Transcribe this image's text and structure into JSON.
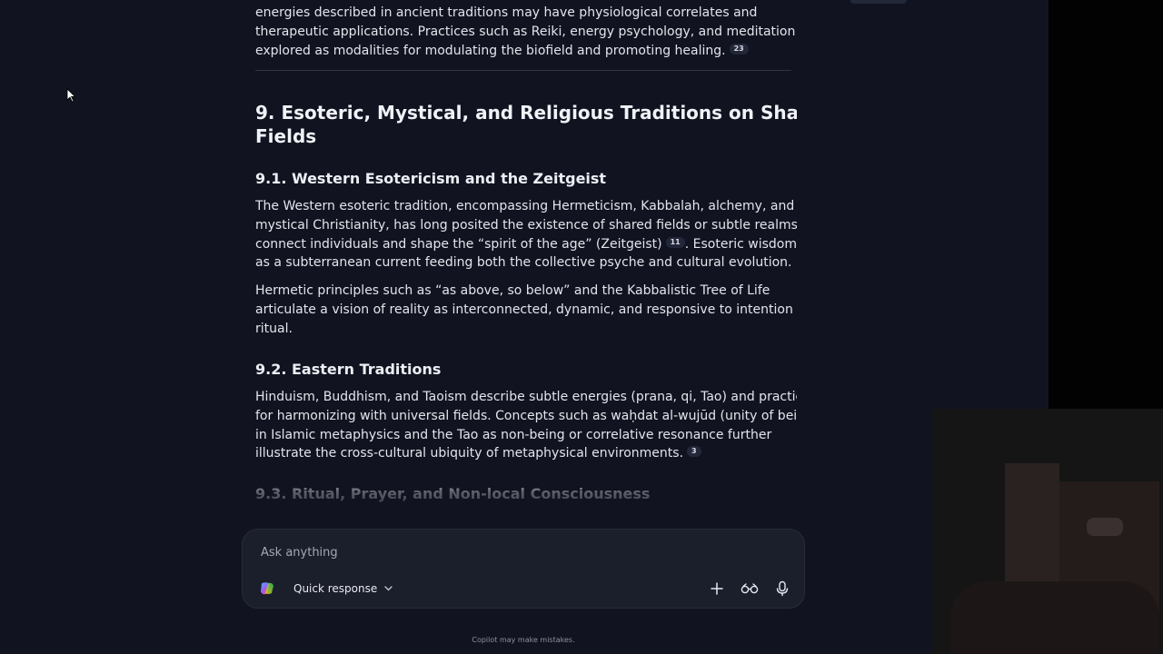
{
  "article": {
    "intro_paragraph": {
      "lines": [
        "energies described in ancient traditions may have physiological correlates and",
        "therapeutic applications. Practices such as Reiki, energy psychology, and meditation are",
        "explored as modalities for modulating the biofield and promoting healing."
      ],
      "citation": "23"
    },
    "section_heading": {
      "line1": "9. Esoteric, Mystical, and Religious Traditions on Shared",
      "line2": "Fields"
    },
    "subsection_1": {
      "heading": "9.1. Western Esotericism and the Zeitgeist",
      "paragraph_1": {
        "line1": "The Western esoteric tradition, encompassing Hermeticism, Kabbalah, alchemy, and",
        "line2": "mystical Christianity, has long posited the existence of shared fields or subtle realms that",
        "line3_before": "connect individuals and shape the “spirit of the age” (Zeitgeist)",
        "line3_citation": "11",
        "line3_after": ". Esoteric wisdom acts",
        "line4": "as a subterranean current feeding both the collective psyche and cultural evolution."
      },
      "paragraph_2": {
        "lines": [
          "Hermetic principles such as “as above, so below” and the Kabbalistic Tree of Life",
          "articulate a vision of reality as interconnected, dynamic, and responsive to intention and",
          "ritual."
        ]
      }
    },
    "subsection_2": {
      "heading": "9.2. Eastern Traditions",
      "paragraph": {
        "line1": "Hinduism, Buddhism, and Taoism describe subtle energies (prana, qi, Tao) and practices",
        "line2": "for harmonizing with universal fields. Concepts such as waḥdat al-wujūd (unity of being)",
        "line3": "in Islamic metaphysics and the Tao as non-being or correlative resonance further",
        "line4": "illustrate the cross-cultural ubiquity of metaphysical environments.",
        "citation": "3"
      }
    },
    "subsection_3": {
      "heading": "9.3. Ritual, Prayer, and Non-local Consciousness"
    }
  },
  "composer": {
    "placeholder": "Ask anything",
    "mode_label": "Quick response",
    "icons": {
      "logo": "copilot-logo-icon",
      "mode": "chevron-down-icon",
      "add": "plus-icon",
      "vision": "glasses-icon",
      "voice": "microphone-icon"
    }
  },
  "footer": {
    "disclaimer": "Copilot may make mistakes."
  },
  "colors": {
    "background": "#111420",
    "composer_background": "#1b1e2b",
    "text": "#e3e5ec",
    "muted_text": "#8b90a2"
  }
}
